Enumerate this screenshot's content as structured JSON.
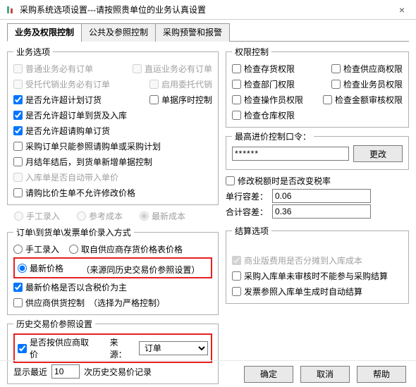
{
  "window": {
    "title": "采购系统选项设置---请按照贵单位的业务认真设置",
    "close": "×"
  },
  "tabs": {
    "t1": "业务及权限控制",
    "t2": "公共及参照控制",
    "t3": "采购预警和报警"
  },
  "left": {
    "biz_legend": "业务选项",
    "c1a": "普通业务必有订单",
    "c1b": "直运业务必有订单",
    "c2a": "受托代销业务必有订单",
    "c2b": "启用委托代销",
    "c3a": "是否允许超计划订货",
    "c3b": "单据序时控制",
    "c4": "是否允许超订单到货及入库",
    "c5": "是否允许超请购单订货",
    "c6": "采购订单只能参照请购单或采购计划",
    "c7": "月结年结后，到货单新增单据控制",
    "c8": "入库单是否自动带入单价",
    "c9": "请购比价生单不允许修改价格",
    "radios_legend": "",
    "r1": "手工录入",
    "r2": "参考成本",
    "r3": "最新成本",
    "p_legend": "订单\\到货单\\发票单价录入方式",
    "pr1": "手工录入",
    "pr2": "取自供应商存货价格表价格",
    "pr3": "最新价格",
    "pr3_extra": "（来源同历史交易价参照设置）",
    "pc1": "最新价格是否以含税价为主",
    "pc2": "供应商供货控制",
    "pc2_extra": "（选择为严格控制）",
    "h_legend": "历史交易价参照设置",
    "h_c1": "是否按供应商取价",
    "h_src_lbl": "来源：",
    "h_src_val": "订单",
    "h_show_lbl": "显示最近",
    "h_show_val": "10",
    "h_show_suffix": "次历史交易价记录"
  },
  "right": {
    "perm_legend": "权限控制",
    "pc1": "检查存货权限",
    "pc2": "检查供应商权限",
    "pc3": "检查部门权限",
    "pc4": "检查业务员权限",
    "pc5": "检查操作员权限",
    "pc6": "检查金额审核权限",
    "pc7": "检查仓库权限",
    "pw_lbl": "最高进价控制口令：",
    "pw_val": "******",
    "pw_btn": "更改",
    "tax_c": "修改税额时是否改变税率",
    "unit_lbl": "单行容差：",
    "unit_val": "0.06",
    "sum_lbl": "合计容差：",
    "sum_val": "0.36",
    "s_legend": "结算选项",
    "sc1": "商业版费用是否分摊到入库成本",
    "sc2": "采购入库单未审核时不能参与采购结算",
    "sc3": "发票参照入库单生成时自动结算"
  },
  "footer": {
    "ok": "确定",
    "cancel": "取消",
    "help": "帮助"
  }
}
